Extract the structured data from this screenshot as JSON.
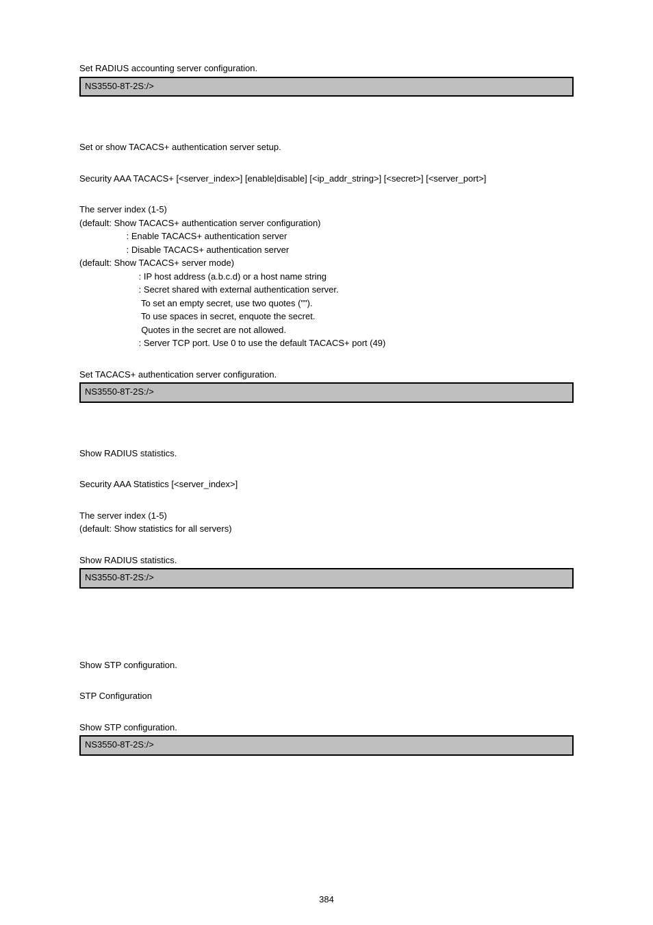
{
  "sections": [
    {
      "pre_line": "Set RADIUS accounting server configuration.",
      "code": "NS3550-8T-2S:/>"
    },
    {
      "intro": "Set or show TACACS+ authentication server setup.",
      "syntax": "Security AAA TACACS+ [<server_index>] [enable|disable] [<ip_addr_string>] [<secret>] [<server_port>]",
      "params": [
        "The server index (1-5)",
        "(default: Show TACACS+ authentication server configuration)",
        "                   : Enable TACACS+ authentication server",
        "                   : Disable TACACS+ authentication server",
        "(default: Show TACACS+ server mode)",
        "                        : IP host address (a.b.c.d) or a host name string",
        "                        : Secret shared with external authentication server.",
        "                         To set an empty secret, use two quotes (\"\").",
        "                         To use spaces in secret, enquote the secret.",
        "                         Quotes in the secret are not allowed.",
        "                        : Server TCP port. Use 0 to use the default TACACS+ port (49)"
      ],
      "pre_line": "Set TACACS+ authentication server configuration.",
      "code": "NS3550-8T-2S:/>"
    },
    {
      "intro": "Show RADIUS statistics.",
      "syntax": "Security AAA Statistics [<server_index>]",
      "params": [
        "The server index (1-5)",
        "(default: Show statistics for all servers)"
      ],
      "pre_line": "Show RADIUS statistics.",
      "code": "NS3550-8T-2S:/>"
    },
    {
      "intro": "Show STP configuration.",
      "syntax": "STP Configuration",
      "pre_line": "Show STP configuration.",
      "code": "NS3550-8T-2S:/>"
    }
  ],
  "page_number": "384"
}
